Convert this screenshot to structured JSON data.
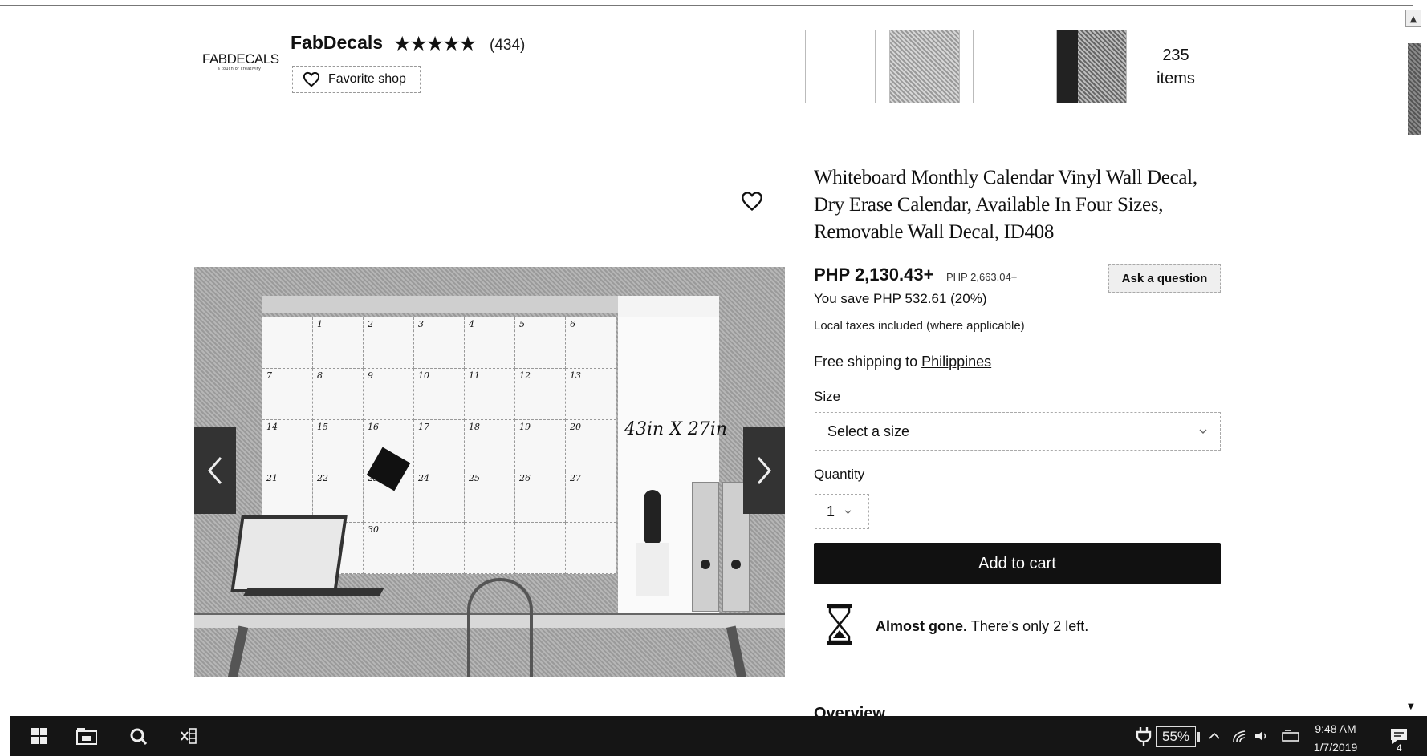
{
  "shop": {
    "logo_text": "FABDECALS",
    "logo_tagline": "a touch of creativity",
    "name": "FabDecals",
    "rating_stars": "★★★★★",
    "review_count": "(434)",
    "favorite_label": "Favorite shop"
  },
  "thumbnails": {
    "items_count": "235",
    "items_label": "items"
  },
  "listing_image": {
    "calendar_days": [
      "",
      "1",
      "2",
      "3",
      "4",
      "5",
      "6",
      "7",
      "8",
      "9",
      "10",
      "11",
      "12",
      "13",
      "14",
      "15",
      "16",
      "17",
      "18",
      "19",
      "20",
      "21",
      "22",
      "23",
      "24",
      "25",
      "26",
      "27",
      "",
      "",
      "30",
      "",
      "",
      "",
      ""
    ],
    "size_text": "43in X 27in"
  },
  "product": {
    "title": "Whiteboard Monthly Calendar Vinyl Wall Decal, Dry Erase Calendar, Available In Four Sizes, Removable Wall Decal, ID408",
    "price": "PHP 2,130.43+",
    "original_price": "PHP 2,663.04+",
    "savings": "You save PHP 532.61 (20%)",
    "taxes_note": "Local taxes included (where applicable)",
    "shipping_prefix": "Free shipping to",
    "shipping_country": "Philippines",
    "ask_question_label": "Ask a question",
    "size_label": "Size",
    "size_placeholder": "Select a size",
    "quantity_label": "Quantity",
    "quantity_value": "1",
    "add_to_cart_label": "Add to cart",
    "stock_bold": "Almost gone.",
    "stock_rest": "There's only 2 left.",
    "overview_heading": "Overview"
  },
  "taskbar": {
    "battery_percent": "55%",
    "time": "9:48 AM",
    "date": "1/7/2019",
    "notification_count": "4"
  },
  "icons": {
    "favorite": "heart-icon",
    "prev": "chevron-left-icon",
    "next": "chevron-right-icon",
    "stock": "hourglass-icon",
    "dropdown": "chevron-down-icon",
    "start": "windows-start-icon",
    "explorer": "file-explorer-icon",
    "app": "app-icon",
    "excel": "excel-icon",
    "power": "power-plug-icon",
    "tray": "chevron-up-icon",
    "wifi": "wifi-icon",
    "volume": "volume-icon",
    "keyboard": "input-indicator-icon",
    "notifications": "action-center-icon"
  }
}
